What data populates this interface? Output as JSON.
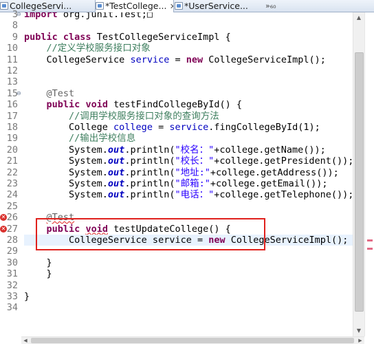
{
  "tabs": [
    {
      "label": "CollegeServi...",
      "icon": "java-file-icon",
      "active": false
    },
    {
      "label": "*TestCollege...",
      "icon": "java-file-icon",
      "active": true,
      "close": "✕"
    },
    {
      "label": "*UserService...",
      "icon": "java-file-icon",
      "active": false
    }
  ],
  "tab_overflow": "»₆₀",
  "colors": {
    "keyword": "#7f0055",
    "comment": "#3f7f5f",
    "string": "#2a00ff",
    "annotation": "#646464",
    "field": "#0000c0",
    "error": "#e0201c",
    "current_line": "#e8f2fe"
  },
  "editor": {
    "lines": [
      {
        "n": "3",
        "text": "import org.junit.Test;□"
      },
      {
        "n": "8",
        "text": ""
      },
      {
        "n": "9",
        "text": "public class TestCollegeServiceImpl {"
      },
      {
        "n": "10",
        "text": "    //定义学校服务接口对象"
      },
      {
        "n": "11",
        "text": "    CollegeService service = new CollegeServiceImpl();"
      },
      {
        "n": "12",
        "text": ""
      },
      {
        "n": "13",
        "text": ""
      },
      {
        "n": "15",
        "text": "    @Test"
      },
      {
        "n": "16",
        "text": "    public void testFindCollegeById() {"
      },
      {
        "n": "17",
        "text": "        //调用学校服务接口对象的查询方法"
      },
      {
        "n": "18",
        "text": "        College college = service.fingCollegeById(1);"
      },
      {
        "n": "19",
        "text": "        //输出学校信息"
      },
      {
        "n": "20",
        "text": "        System.out.println(\"校名：\"+college.getName());"
      },
      {
        "n": "21",
        "text": "        System.out.println(\"校长：\"+college.getPresident());"
      },
      {
        "n": "22",
        "text": "        System.out.println(\"地址:\"+college.getAddress());"
      },
      {
        "n": "23",
        "text": "        System.out.println(\"邮箱:\"+college.getEmail());"
      },
      {
        "n": "24",
        "text": "        System.out.println(\"电话：\"+college.getTelephone());"
      },
      {
        "n": "25",
        "text": ""
      },
      {
        "n": "26",
        "text": "    @Test"
      },
      {
        "n": "27",
        "text": "    public void testUpdateCollege() {"
      },
      {
        "n": "28",
        "text": "        CollegeService service = new CollegeServiceImpl();"
      },
      {
        "n": "29",
        "text": ""
      },
      {
        "n": "30",
        "text": "    }"
      },
      {
        "n": "31",
        "text": "    }"
      },
      {
        "n": "32",
        "text": ""
      },
      {
        "n": "33",
        "text": "}"
      },
      {
        "n": "34",
        "text": ""
      }
    ]
  }
}
